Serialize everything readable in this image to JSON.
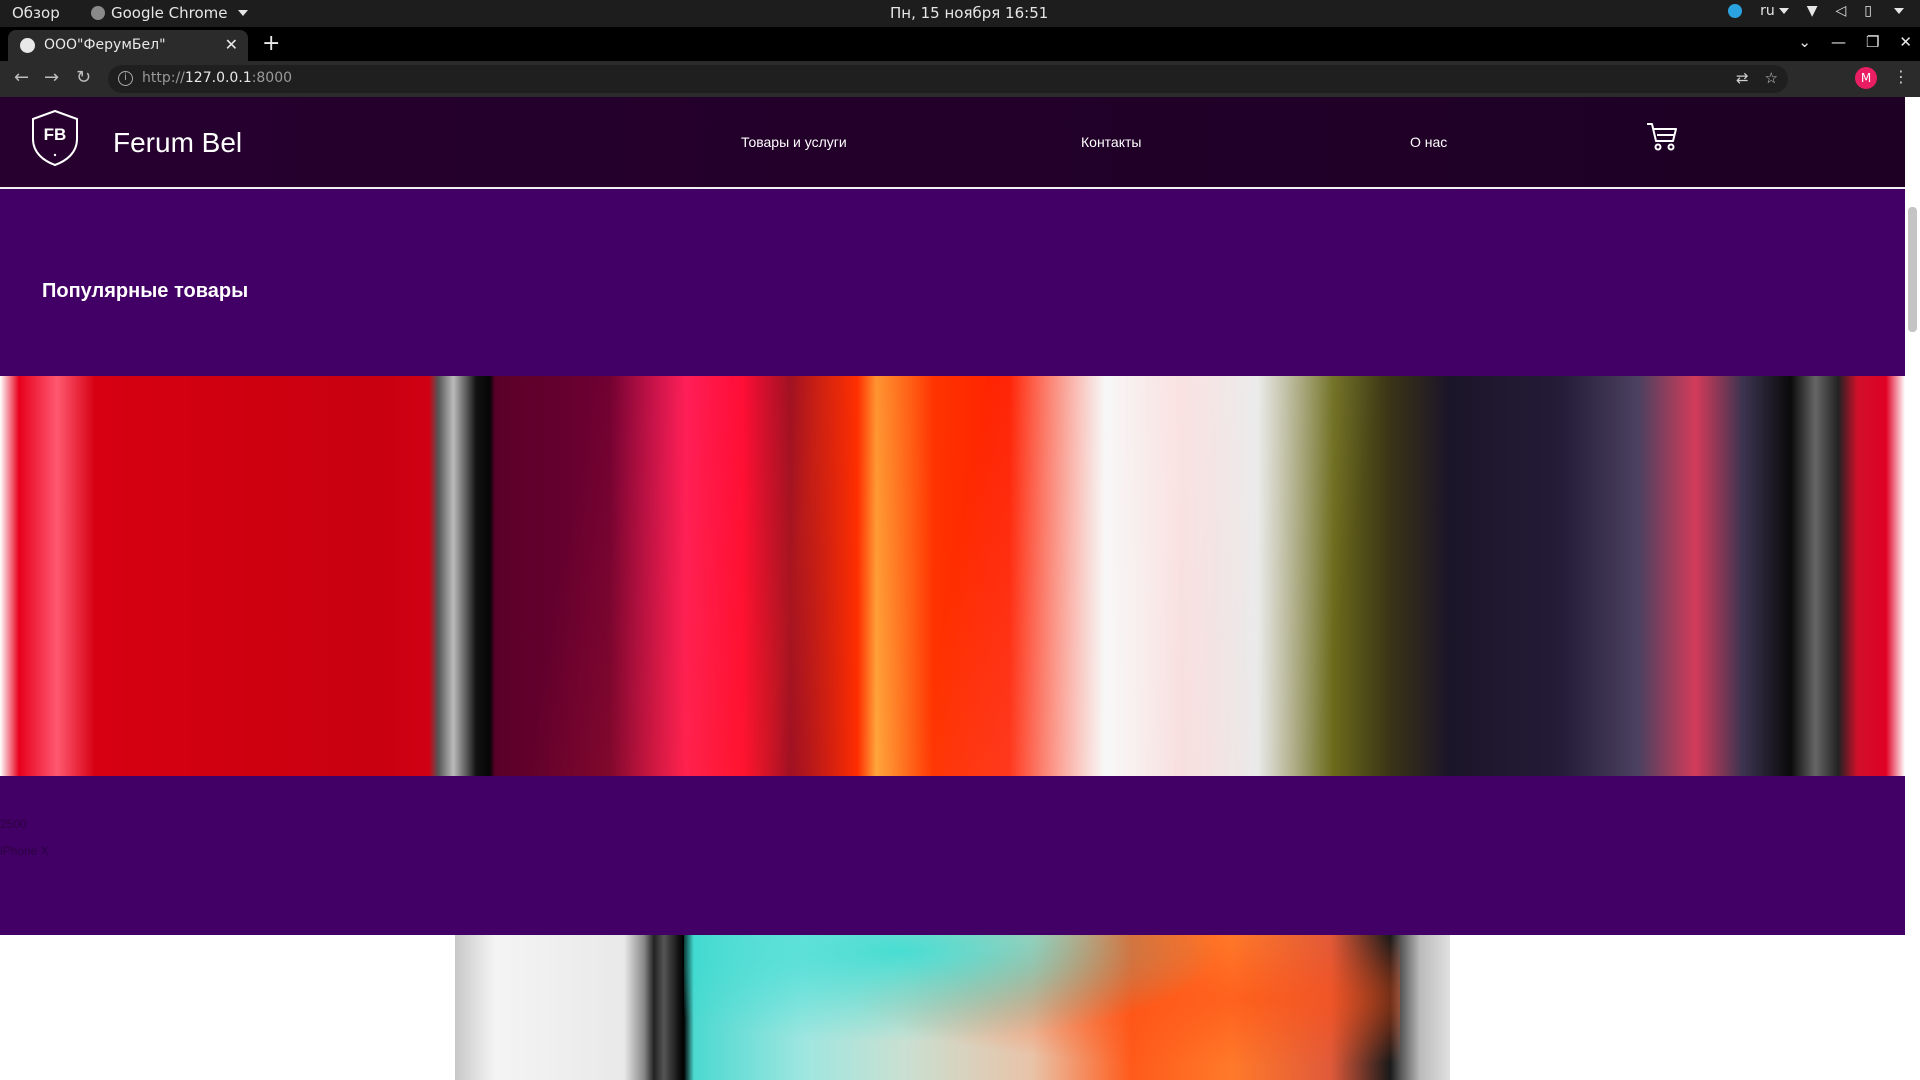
{
  "system_bar": {
    "overview": "Обзор",
    "app_name": "Google Chrome",
    "clock": "Пн, 15 ноября  16:51",
    "language": "ru"
  },
  "browser": {
    "tab_title": "ООО\"ФерумБел\"",
    "url_prefix": "http://",
    "url_host": "127.0.0.1",
    "url_port": ":8000",
    "profile_initial": "M"
  },
  "site": {
    "logo_text": "FB",
    "brand": "Ferum Bel",
    "nav": [
      "Товары и услуги",
      "Контакты",
      "О нас"
    ],
    "section_title": "Популярные товары",
    "products": [
      {
        "price": "2500",
        "name": "iPhone X"
      }
    ]
  },
  "colors": {
    "page_bg": "#420066",
    "header_bg": "#27002f",
    "accent_avatar": "#e91e63"
  }
}
